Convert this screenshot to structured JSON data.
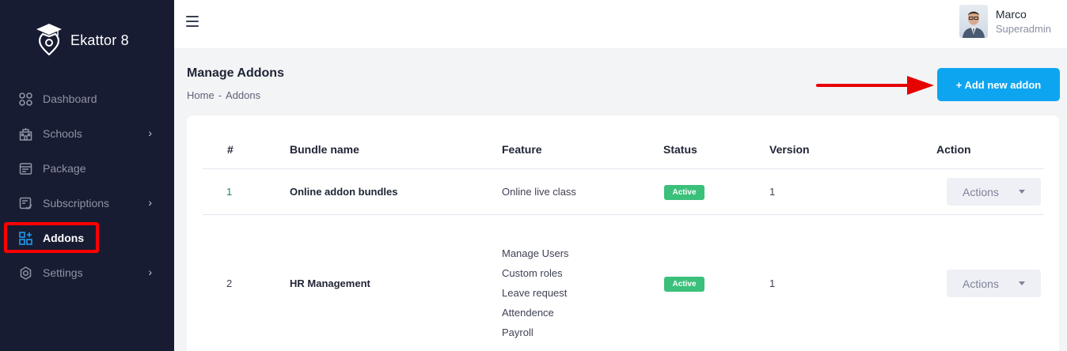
{
  "app": {
    "name": "Ekattor 8"
  },
  "sidebar": {
    "items": [
      {
        "label": "Dashboard",
        "icon": "dashboard-icon",
        "has_submenu": false
      },
      {
        "label": "Schools",
        "icon": "school-icon",
        "has_submenu": true
      },
      {
        "label": "Package",
        "icon": "package-icon",
        "has_submenu": false
      },
      {
        "label": "Subscriptions",
        "icon": "subscription-icon",
        "has_submenu": true
      },
      {
        "label": "Addons",
        "icon": "addons-icon",
        "has_submenu": false,
        "active": true
      },
      {
        "label": "Settings",
        "icon": "settings-icon",
        "has_submenu": true
      }
    ]
  },
  "user": {
    "name": "Marco",
    "role": "Superadmin"
  },
  "page": {
    "title": "Manage Addons",
    "breadcrumb": [
      "Home",
      "Addons"
    ],
    "breadcrumb_sep": "-",
    "add_button": "+ Add new addon"
  },
  "table": {
    "headers": [
      "#",
      "Bundle name",
      "Feature",
      "Status",
      "Version",
      "Action"
    ],
    "rows": [
      {
        "num": "1",
        "name": "Online addon bundles",
        "features": [
          "Online live class"
        ],
        "status": "Active",
        "version": "1",
        "action": "Actions"
      },
      {
        "num": "2",
        "name": "HR Management",
        "features": [
          "Manage Users",
          "Custom roles",
          "Leave request",
          "Attendence",
          "Payroll"
        ],
        "status": "Active",
        "version": "1",
        "action": "Actions"
      }
    ]
  },
  "colors": {
    "sidebar_bg": "#181c32",
    "accent": "#0ea5f0",
    "active_badge": "#3ac07a",
    "highlight": "#ff0000"
  }
}
